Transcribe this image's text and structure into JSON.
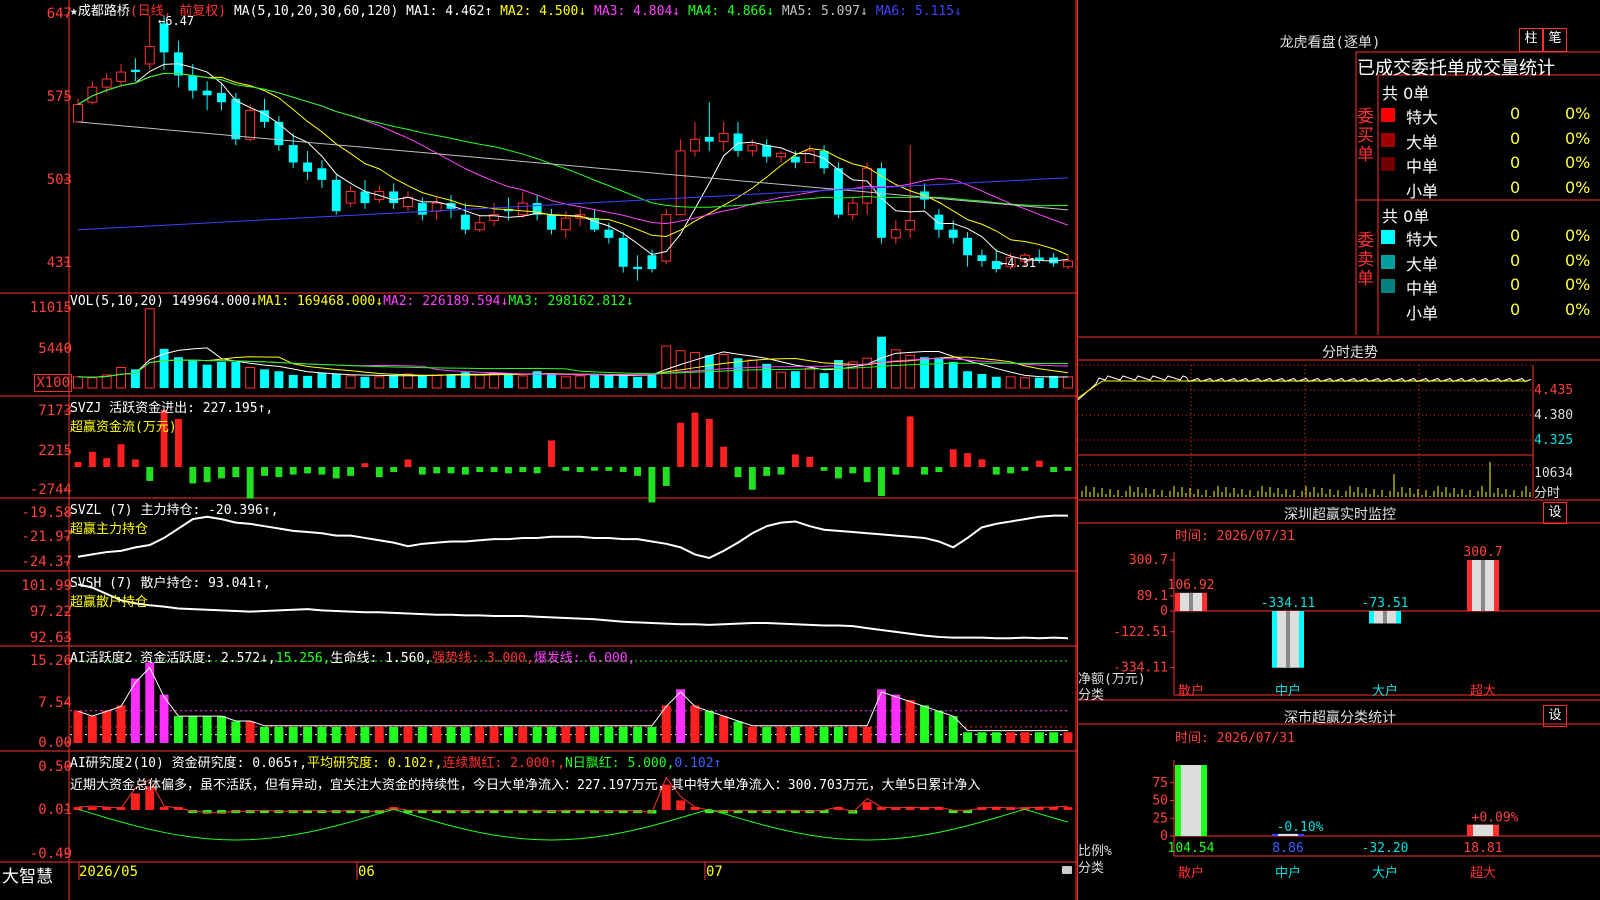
{
  "header": {
    "stock_name": "★成都路桥",
    "period": "(日线, 前复权)",
    "ma_prefix": "MA(5,10,20,30,60,120)",
    "ma": [
      {
        "text": "MA1: 4.462↑",
        "color": "#ffffff"
      },
      {
        "text": "MA2: 4.500↓",
        "color": "#ffff00"
      },
      {
        "text": "MA3: 4.804↓",
        "color": "#ff40ff"
      },
      {
        "text": "MA4: 4.866↓",
        "color": "#20ff20"
      },
      {
        "text": "MA5: 5.097↓",
        "color": "#c0c0c0"
      },
      {
        "text": "MA6: 5.115↓",
        "color": "#4040ff"
      }
    ],
    "high_mark": "←6.47",
    "low_mark": "←4.31"
  },
  "axes": {
    "price": [
      "647",
      "575",
      "503",
      "431"
    ],
    "vol": [
      "11015",
      "5440",
      "X100"
    ],
    "svzj": [
      "7173",
      "2215",
      "-2744"
    ],
    "svzl": [
      "-19.58",
      "-21.97",
      "-24.37"
    ],
    "svsh": [
      "101.99",
      "97.22",
      "92.63"
    ],
    "ai1": [
      "15.26",
      "7.54",
      "0.00"
    ],
    "ai2": [
      "0.50",
      "0.01",
      "-0.49"
    ]
  },
  "vol_header": {
    "prefix": "VOL(5,10,20)",
    "items": [
      {
        "text": "149964.000↓",
        "color": "#ffffff"
      },
      {
        "text": "MA1: 169468.000↓",
        "color": "#ffff00"
      },
      {
        "text": "MA2: 226189.594↓",
        "color": "#ff40ff"
      },
      {
        "text": "MA3: 298162.812↓",
        "color": "#20ff20"
      }
    ]
  },
  "svzj_header": {
    "line1": "SVZJ  活跃资金进出: 227.195↑,",
    "line2": "超赢资金流(万元)"
  },
  "svzl_header": {
    "line1": "SVZL (7) 主力持仓: -20.396↑,",
    "line2": "超赢主力持仓"
  },
  "svsh_header": {
    "line1": "SVSH (7) 散户持仓: 93.041↑,",
    "line2": "超赢散户持仓"
  },
  "ai1_header": {
    "items": [
      {
        "text": "AI活跃度2 资金活跃度: 2.572↓,",
        "color": "#ffffff"
      },
      {
        "text": "15.256,",
        "color": "#20ff20"
      },
      {
        "text": "生命线: 1.560,",
        "color": "#ffffff"
      },
      {
        "text": "强势线: 3.000,",
        "color": "#ff3030"
      },
      {
        "text": "爆发线: 6.000,",
        "color": "#ff40ff"
      }
    ]
  },
  "ai2_header": {
    "items": [
      {
        "text": "AI研究度2(10) 资金研究度: 0.065↑,",
        "color": "#ffffff"
      },
      {
        "text": "平均研究度: 0.102↑,",
        "color": "#ffff00"
      },
      {
        "text": "连续飘红: 2.000↑,",
        "color": "#ff3030"
      },
      {
        "text": "N日飘红: 5.000,",
        "color": "#20ff20"
      },
      {
        "text": "0.102↑",
        "color": "#4060ff"
      }
    ],
    "comment": "近期大资金总体偏多，虽不活跃，但有异动，宜关注大资金的持续性，今日大单净流入：227.197万元，其中特大单净流入：300.703万元，大单5日累计净入"
  },
  "bottom_bar": {
    "brand": "大智慧",
    "dates": [
      "2026/05",
      "06",
      "07"
    ]
  },
  "right_panel": {
    "longhu_title": "龙虎看盘(逐单)",
    "btn_bar": "柱",
    "btn_pen": "笔",
    "stat_title": "已成交委托单成交量统计",
    "buy_label": "委买单",
    "sell_label": "委卖单",
    "buy_total": "共 0单",
    "sell_total": "共 0单",
    "buy_rows": [
      {
        "name": "特大",
        "count": "0",
        "pct": "0%",
        "color": "#ff0000"
      },
      {
        "name": "大单",
        "count": "0",
        "pct": "0%",
        "color": "#a00000"
      },
      {
        "name": "中单",
        "count": "0",
        "pct": "0%",
        "color": "#700000"
      },
      {
        "name": "小单",
        "count": "0",
        "pct": "0%",
        "color": "#000000"
      }
    ],
    "sell_rows": [
      {
        "name": "特大",
        "count": "0",
        "pct": "0%",
        "color": "#00ffff"
      },
      {
        "name": "大单",
        "count": "0",
        "pct": "0%",
        "color": "#00a0a0"
      },
      {
        "name": "中单",
        "count": "0",
        "pct": "0%",
        "color": "#008080"
      },
      {
        "name": "小单",
        "count": "0",
        "pct": "0%",
        "color": "#000000"
      }
    ],
    "intraday_title": "分时走势",
    "intraday_prices": [
      "4.435",
      "4.380",
      "4.325"
    ],
    "intraday_vol": "10634",
    "intraday_vol_label": "分时",
    "monitor_title": "深圳超赢实时监控",
    "monitor_btn": "设",
    "monitor_time": "时间: 2026/07/31",
    "monitor_axis": [
      "300.7",
      "89.1",
      "0",
      "-122.51",
      "-334.11"
    ],
    "monitor_ylabel": "净额(万元)",
    "monitor_xlabel": "分类",
    "monitor_bars": [
      {
        "cat": "散户",
        "value": "106.92"
      },
      {
        "cat": "中户",
        "value": "-334.11"
      },
      {
        "cat": "大户",
        "value": "-73.51"
      },
      {
        "cat": "超大",
        "value": "300.7"
      }
    ],
    "class_title": "深市超赢分类统计",
    "class_btn": "设",
    "class_time": "时间: 2026/07/31",
    "class_axis": [
      "75",
      "50",
      "25",
      "0"
    ],
    "class_ylabel": "比例%",
    "class_xlabel": "分类",
    "class_bars": [
      {
        "cat": "散户",
        "value": "104.54",
        "label": ""
      },
      {
        "cat": "中户",
        "value": "8.86",
        "label": "-0.10%"
      },
      {
        "cat": "大户",
        "value": "-32.20",
        "label": ""
      },
      {
        "cat": "超大",
        "value": "18.81",
        "label": "+0.09%"
      }
    ]
  },
  "chart_data": {
    "type": "candlestick",
    "x_labels": [
      "2026/05",
      "06",
      "07"
    ],
    "price_range": [
      4.31,
      6.47
    ],
    "candles": [
      [
        5.55,
        5.7,
        5.55,
        5.75
      ],
      [
        5.72,
        5.85,
        5.7,
        5.9
      ],
      [
        5.85,
        5.92,
        5.8,
        5.97
      ],
      [
        5.9,
        5.98,
        5.85,
        6.05
      ],
      [
        6.0,
        5.98,
        5.9,
        6.1
      ],
      [
        6.05,
        6.2,
        6.0,
        6.47
      ],
      [
        6.4,
        6.15,
        6.0,
        6.47
      ],
      [
        6.15,
        5.95,
        5.85,
        6.25
      ],
      [
        5.95,
        5.82,
        5.75,
        6.05
      ],
      [
        5.82,
        5.78,
        5.65,
        5.9
      ],
      [
        5.8,
        5.72,
        5.65,
        5.88
      ],
      [
        5.75,
        5.4,
        5.35,
        5.8
      ],
      [
        5.4,
        5.65,
        5.38,
        5.7
      ],
      [
        5.65,
        5.55,
        5.5,
        5.75
      ],
      [
        5.55,
        5.35,
        5.3,
        5.6
      ],
      [
        5.35,
        5.2,
        5.15,
        5.45
      ],
      [
        5.2,
        5.12,
        5.05,
        5.3
      ],
      [
        5.15,
        5.05,
        4.98,
        5.22
      ],
      [
        5.05,
        4.78,
        4.75,
        5.1
      ],
      [
        4.85,
        4.95,
        4.82,
        5.0
      ],
      [
        4.95,
        4.85,
        4.8,
        5.05
      ],
      [
        4.88,
        4.95,
        4.85,
        5.0
      ],
      [
        4.95,
        4.85,
        4.8,
        5.02
      ],
      [
        4.82,
        4.9,
        4.78,
        4.95
      ],
      [
        4.85,
        4.75,
        4.7,
        4.9
      ],
      [
        4.78,
        4.85,
        4.7,
        4.9
      ],
      [
        4.85,
        4.8,
        4.72,
        4.92
      ],
      [
        4.75,
        4.62,
        4.58,
        4.85
      ],
      [
        4.62,
        4.68,
        4.6,
        4.75
      ],
      [
        4.7,
        4.75,
        4.65,
        4.85
      ],
      [
        4.8,
        4.78,
        4.7,
        4.9
      ],
      [
        4.75,
        4.85,
        4.72,
        4.95
      ],
      [
        4.85,
        4.75,
        4.7,
        4.92
      ],
      [
        4.75,
        4.62,
        4.58,
        4.8
      ],
      [
        4.62,
        4.72,
        4.55,
        4.78
      ],
      [
        4.72,
        4.75,
        4.65,
        4.8
      ],
      [
        4.72,
        4.62,
        4.6,
        4.8
      ],
      [
        4.62,
        4.55,
        4.5,
        4.68
      ],
      [
        4.55,
        4.3,
        4.25,
        4.6
      ],
      [
        4.3,
        4.28,
        4.18,
        4.4
      ],
      [
        4.4,
        4.28,
        4.25,
        4.45
      ],
      [
        4.35,
        4.75,
        4.32,
        4.8
      ],
      [
        4.75,
        5.3,
        4.75,
        5.4
      ],
      [
        5.3,
        5.4,
        5.25,
        5.55
      ],
      [
        5.42,
        5.38,
        5.3,
        5.72
      ],
      [
        5.38,
        5.45,
        5.3,
        5.55
      ],
      [
        5.45,
        5.3,
        5.25,
        5.55
      ],
      [
        5.3,
        5.35,
        5.25,
        5.4
      ],
      [
        5.35,
        5.25,
        5.2,
        5.4
      ],
      [
        5.25,
        5.28,
        5.2,
        5.3
      ],
      [
        5.25,
        5.2,
        5.15,
        5.3
      ],
      [
        5.2,
        5.3,
        5.2,
        5.35
      ],
      [
        5.3,
        5.15,
        5.1,
        5.35
      ],
      [
        5.15,
        4.75,
        4.72,
        5.2
      ],
      [
        4.75,
        4.85,
        4.7,
        4.9
      ],
      [
        4.85,
        5.15,
        4.75,
        5.2
      ],
      [
        5.15,
        4.55,
        4.5,
        5.2
      ],
      [
        4.55,
        4.62,
        4.5,
        4.7
      ],
      [
        4.62,
        4.7,
        4.55,
        5.35
      ],
      [
        4.95,
        4.88,
        4.8,
        5.02
      ],
      [
        4.75,
        4.62,
        4.55,
        4.8
      ],
      [
        4.62,
        4.55,
        4.5,
        4.7
      ],
      [
        4.55,
        4.4,
        4.3,
        4.6
      ],
      [
        4.4,
        4.35,
        4.3,
        4.45
      ],
      [
        4.35,
        4.28,
        4.25,
        4.45
      ],
      [
        4.3,
        4.38,
        4.28,
        4.42
      ],
      [
        4.35,
        4.4,
        4.3,
        4.42
      ],
      [
        4.38,
        4.36,
        4.33,
        4.45
      ],
      [
        4.38,
        4.33,
        4.3,
        4.42
      ],
      [
        4.3,
        4.35,
        4.28,
        4.4
      ]
    ],
    "volume": [
      12,
      11,
      14,
      22,
      20,
      85,
      42,
      33,
      30,
      25,
      28,
      28,
      22,
      20,
      18,
      14,
      13,
      16,
      15,
      13,
      12,
      12,
      14,
      15,
      13,
      14,
      15,
      17,
      14,
      16,
      15,
      13,
      18,
      15,
      12,
      13,
      15,
      14,
      14,
      12,
      15,
      45,
      40,
      38,
      35,
      36,
      32,
      30,
      26,
      17,
      18,
      21,
      16,
      30,
      28,
      32,
      55,
      41,
      35,
      33,
      32,
      28,
      18,
      15,
      12,
      12,
      11,
      11,
      13,
      12
    ],
    "svzj": [
      400,
      1200,
      700,
      1800,
      600,
      -1100,
      4500,
      3800,
      -1300,
      -1200,
      -900,
      -800,
      -2500,
      -700,
      -800,
      -600,
      -500,
      -600,
      -900,
      -700,
      300,
      -800,
      -400,
      600,
      -600,
      -500,
      -500,
      -600,
      -400,
      -400,
      -500,
      -400,
      -500,
      2100,
      -300,
      -400,
      -300,
      -300,
      -400,
      -700,
      -2800,
      -1500,
      3500,
      4300,
      3800,
      1600,
      -800,
      -1800,
      -700,
      -600,
      1000,
      800,
      -300,
      -900,
      -500,
      -1200,
      -2300,
      -600,
      4000,
      -600,
      -400,
      1400,
      1100,
      600,
      -600,
      -500,
      -300,
      500,
      -400,
      -300
    ],
    "svzl": [
      -23.8,
      -23.6,
      -23.4,
      -23.3,
      -23.0,
      -22.8,
      -22.2,
      -21.4,
      -20.6,
      -20.4,
      -20.6,
      -20.9,
      -21.0,
      -21.2,
      -21.4,
      -21.6,
      -21.7,
      -21.8,
      -22.0,
      -22.0,
      -22.2,
      -22.4,
      -22.6,
      -22.9,
      -22.7,
      -22.6,
      -22.5,
      -22.5,
      -22.4,
      -22.3,
      -22.3,
      -22.2,
      -22.2,
      -22.1,
      -22.1,
      -22.1,
      -22.2,
      -22.2,
      -22.3,
      -22.3,
      -22.5,
      -22.7,
      -23.0,
      -23.6,
      -23.9,
      -23.3,
      -22.6,
      -21.8,
      -21.2,
      -20.9,
      -20.8,
      -21.2,
      -21.5,
      -21.6,
      -21.7,
      -21.8,
      -21.9,
      -22.0,
      -22.1,
      -22.2,
      -22.5,
      -23.0,
      -22.2,
      -21.3,
      -21.0,
      -20.8,
      -20.6,
      -20.4,
      -20.3,
      -20.3
    ],
    "svsh": [
      101.5,
      101.0,
      100.0,
      99.0,
      98.5,
      98.2,
      98.0,
      97.7,
      97.6,
      97.5,
      97.4,
      97.3,
      97.2,
      97.3,
      97.4,
      97.5,
      97.6,
      97.4,
      97.3,
      97.2,
      97.1,
      97.1,
      97.0,
      96.9,
      96.8,
      96.7,
      96.7,
      96.6,
      96.6,
      96.5,
      96.5,
      96.5,
      96.4,
      96.3,
      96.2,
      96.1,
      96.0,
      95.8,
      95.6,
      95.5,
      95.4,
      95.3,
      95.2,
      95.2,
      95.1,
      95.2,
      95.3,
      95.4,
      95.4,
      95.3,
      95.2,
      95.1,
      95.0,
      95.0,
      94.9,
      94.6,
      94.3,
      94.0,
      93.7,
      93.4,
      93.2,
      93.1,
      93.1,
      93.1,
      93.0,
      93.0,
      93.1,
      93.0,
      93.1,
      93.0
    ],
    "ai1": [
      6,
      5,
      6,
      7,
      12,
      15,
      9,
      5,
      5,
      5,
      5,
      4,
      4,
      3,
      3,
      3,
      3,
      3,
      3,
      3,
      3,
      3,
      3,
      3,
      3,
      3,
      3,
      3,
      3,
      3,
      3,
      3,
      3,
      3,
      3,
      3,
      3,
      3,
      3,
      3,
      3,
      7,
      10,
      7,
      6,
      5,
      4,
      3,
      3,
      3,
      3,
      3,
      3,
      3,
      3,
      3,
      10,
      9,
      8,
      7,
      6,
      5,
      2,
      2,
      2,
      2,
      2,
      2,
      2,
      2
    ],
    "ai2": [
      0.02,
      0.03,
      0.02,
      0.01,
      0.2,
      0.28,
      0.03,
      0.01,
      -0.02,
      -0.03,
      -0.03,
      -0.02,
      -0.02,
      -0.01,
      -0.02,
      -0.02,
      -0.01,
      -0.02,
      -0.02,
      -0.01,
      -0.02,
      -0.02,
      0.01,
      -0.01,
      -0.01,
      -0.01,
      -0.01,
      -0.02,
      -0.01,
      -0.01,
      -0.01,
      -0.01,
      -0.01,
      -0.02,
      -0.01,
      -0.01,
      -0.01,
      -0.02,
      -0.01,
      -0.02,
      -0.03,
      0.3,
      0.12,
      0.02,
      -0.01,
      -0.02,
      -0.01,
      -0.01,
      -0.02,
      -0.01,
      -0.01,
      -0.02,
      -0.01,
      0.02,
      -0.03,
      0.1,
      0.02,
      0.01,
      0.02,
      0.01,
      0.02,
      -0.01,
      -0.01,
      0.01,
      0.02,
      0.01,
      0.01,
      0.02,
      0.02,
      0.03
    ]
  }
}
